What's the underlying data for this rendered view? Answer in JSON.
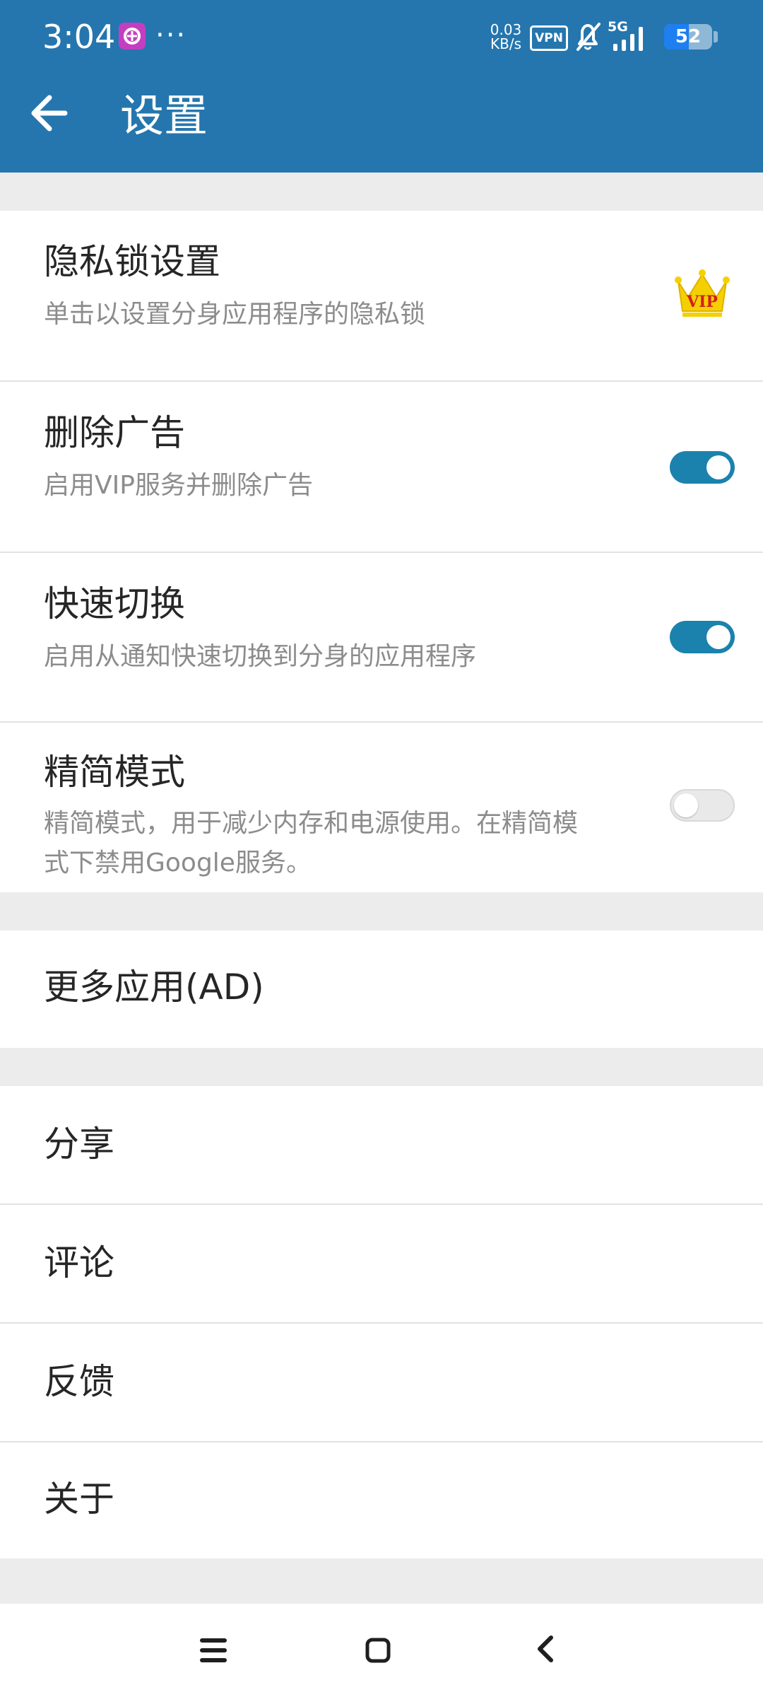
{
  "status_bar": {
    "time": "3:04",
    "more": "···",
    "net_speed_value": "0.03",
    "net_speed_unit": "KB/s",
    "vpn": "VPN",
    "network": "5G",
    "battery": "52",
    "battery_level": 52,
    "icons": [
      "app-notification-icon",
      "mute-bell-icon",
      "signal-icon",
      "battery-icon"
    ]
  },
  "header": {
    "title": "设置",
    "back_icon": "arrow-left-icon"
  },
  "settings": {
    "privacy_lock": {
      "title": "隐私锁设置",
      "subtitle": "单击以设置分身应用程序的隐私锁",
      "icon": "vip-crown-icon",
      "badge": "VIP"
    },
    "remove_ads": {
      "title": "删除广告",
      "subtitle": "启用VIP服务并删除广告",
      "enabled": true
    },
    "quick_switch": {
      "title": "快速切换",
      "subtitle": "启用从通知快速切换到分身的应用程序",
      "enabled": true
    },
    "lite_mode": {
      "title": "精简模式",
      "subtitle_line1": "精简模式，用于减少内存和电源使用。在精简模",
      "subtitle_line2": "式下禁用Google服务。",
      "enabled": false
    }
  },
  "more_apps": {
    "label": "更多应用(AD)"
  },
  "menu": {
    "share": "分享",
    "review": "评论",
    "feedback": "反馈",
    "about": "关于"
  },
  "navigation": {
    "icons": [
      "menu-icon",
      "home-icon",
      "back-icon"
    ]
  },
  "colors": {
    "app_bar": "#2576ae",
    "switch_on": "#1b82ad",
    "background": "#ececec",
    "vip": "#f4d000"
  }
}
